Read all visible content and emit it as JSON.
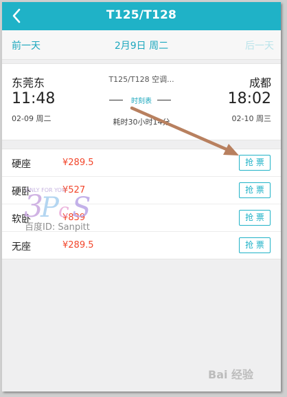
{
  "header": {
    "title": "T125/T128"
  },
  "datebar": {
    "prev_label": "前一天",
    "date_label": "2月9日 周二",
    "next_label": "后一天"
  },
  "trip": {
    "from_station": "东莞东",
    "depart_time": "11:48",
    "depart_date": "02-09 周二",
    "train_code": "T125/T128 空调...",
    "schedule_label": "时刻表",
    "duration": "耗时30小时14分",
    "to_station": "成都",
    "arrive_time": "18:02",
    "arrive_date": "02-10 周三"
  },
  "seats": [
    {
      "name": "硬座",
      "price": "¥289.5",
      "button": "抢 票"
    },
    {
      "name": "硬卧",
      "price": "¥527",
      "button": "抢 票"
    },
    {
      "name": "软卧",
      "price": "¥839",
      "button": "抢 票"
    },
    {
      "name": "无座",
      "price": "¥289.5",
      "button": "抢 票"
    }
  ],
  "watermark": {
    "text": "百度ID: Sanpitt",
    "logo_text": "ONLY FOR YOU"
  },
  "footer": {
    "baidu_text": "Bai 经验"
  },
  "colors": {
    "accent": "#1fb2c7",
    "price": "#f2452a",
    "arrow": "#b8805f"
  }
}
